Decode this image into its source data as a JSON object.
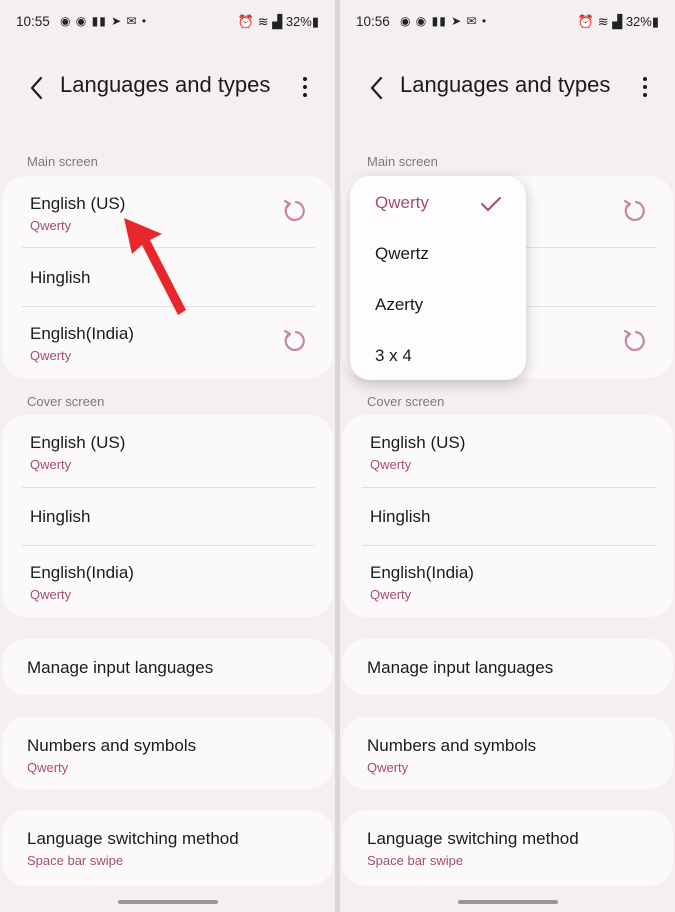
{
  "colors": {
    "accent": "#a54f6a",
    "background": "#f4eff3",
    "card": "#fcf9fb",
    "arrow": "#e8262c"
  },
  "left": {
    "status": {
      "time": "10:55",
      "battery": "32%"
    },
    "header": {
      "title": "Languages and types"
    },
    "main_screen": {
      "label": "Main screen",
      "items": [
        {
          "name": "English (US)",
          "sub": "Qwerty"
        },
        {
          "name": "Hinglish"
        },
        {
          "name": "English(India)",
          "sub": "Qwerty"
        }
      ]
    },
    "cover_screen": {
      "label": "Cover screen",
      "items": [
        {
          "name": "English (US)",
          "sub": "Qwerty"
        },
        {
          "name": "Hinglish"
        },
        {
          "name": "English(India)",
          "sub": "Qwerty"
        }
      ]
    },
    "manage": {
      "label": "Manage input languages"
    },
    "numbers": {
      "label": "Numbers and symbols",
      "sub": "Qwerty"
    },
    "switching": {
      "label": "Language switching method",
      "sub": "Space bar swipe"
    }
  },
  "right": {
    "status": {
      "time": "10:56",
      "battery": "32%"
    },
    "header": {
      "title": "Languages and types"
    },
    "main_screen": {
      "label": "Main screen"
    },
    "cover_screen": {
      "label": "Cover screen",
      "items": [
        {
          "name": "English (US)",
          "sub": "Qwerty"
        },
        {
          "name": "Hinglish"
        },
        {
          "name": "English(India)",
          "sub": "Qwerty"
        }
      ]
    },
    "manage": {
      "label": "Manage input languages"
    },
    "numbers": {
      "label": "Numbers and symbols",
      "sub": "Qwerty"
    },
    "switching": {
      "label": "Language switching method",
      "sub": "Space bar swipe"
    },
    "dropdown": {
      "options": [
        "Qwerty",
        "Qwertz",
        "Azerty",
        "3 x 4"
      ],
      "selected": "Qwerty"
    }
  }
}
